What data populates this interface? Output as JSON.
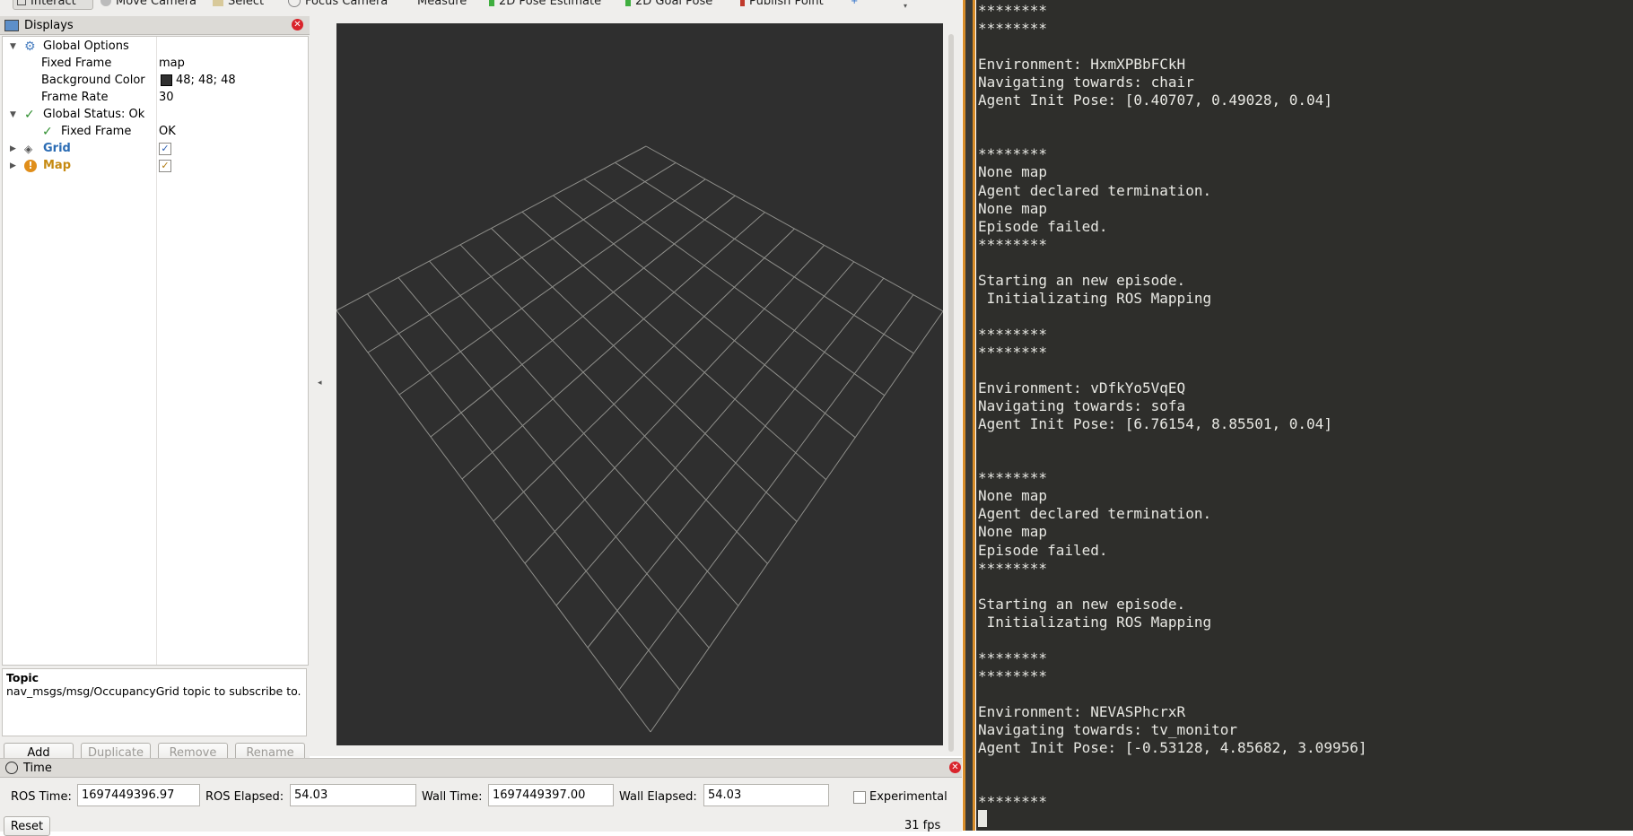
{
  "toolbar": {
    "tools": [
      "Interact",
      "Move Camera",
      "Select",
      "Focus Camera",
      "Measure",
      "2D Pose Estimate",
      "2D Goal Pose",
      "Publish Point"
    ]
  },
  "displays": {
    "title": "Displays",
    "global_options": "Global Options",
    "fixed_frame_label": "Fixed Frame",
    "fixed_frame_value": "map",
    "bg_color_label": "Background Color",
    "bg_color_value": "48; 48; 48",
    "bg_color_swatch": "#303030",
    "frame_rate_label": "Frame Rate",
    "frame_rate_value": "30",
    "global_status": "Global Status: Ok",
    "status_fixed_frame_label": "Fixed Frame",
    "status_fixed_frame_value": "OK",
    "grid_label": "Grid",
    "map_label": "Map"
  },
  "topic": {
    "title": "Topic",
    "description": "nav_msgs/msg/OccupancyGrid topic to subscribe to."
  },
  "buttons": {
    "add": "Add",
    "duplicate": "Duplicate",
    "remove": "Remove",
    "rename": "Rename"
  },
  "time": {
    "title": "Time",
    "ros_time_label": "ROS Time:",
    "ros_time_value": "1697449396.97",
    "ros_elapsed_label": "ROS Elapsed:",
    "ros_elapsed_value": "54.03",
    "wall_time_label": "Wall Time:",
    "wall_time_value": "1697449397.00",
    "wall_elapsed_label": "Wall Elapsed:",
    "wall_elapsed_value": "54.03",
    "experimental_label": "Experimental",
    "reset": "Reset",
    "fps": "31 fps"
  },
  "terminal": {
    "lines": [
      "********",
      "********",
      "",
      "Environment: HxmXPBbFCkH",
      "Navigating towards: chair",
      "Agent Init Pose: [0.40707, 0.49028, 0.04]",
      "",
      "",
      "********",
      "None map",
      "Agent declared termination.",
      "None map",
      "Episode failed.",
      "********",
      "",
      "Starting an new episode.",
      " Initializating ROS Mapping",
      "",
      "********",
      "********",
      "",
      "Environment: vDfkYo5VqEQ",
      "Navigating towards: sofa",
      "Agent Init Pose: [6.76154, 8.85501, 0.04]",
      "",
      "",
      "********",
      "None map",
      "Agent declared termination.",
      "None map",
      "Episode failed.",
      "********",
      "",
      "Starting an new episode.",
      " Initializating ROS Mapping",
      "",
      "********",
      "********",
      "",
      "Environment: NEVASPhcrxR",
      "Navigating towards: tv_monitor",
      "Agent Init Pose: [-0.53128, 4.85682, 3.09956]",
      "",
      "",
      "********"
    ]
  }
}
